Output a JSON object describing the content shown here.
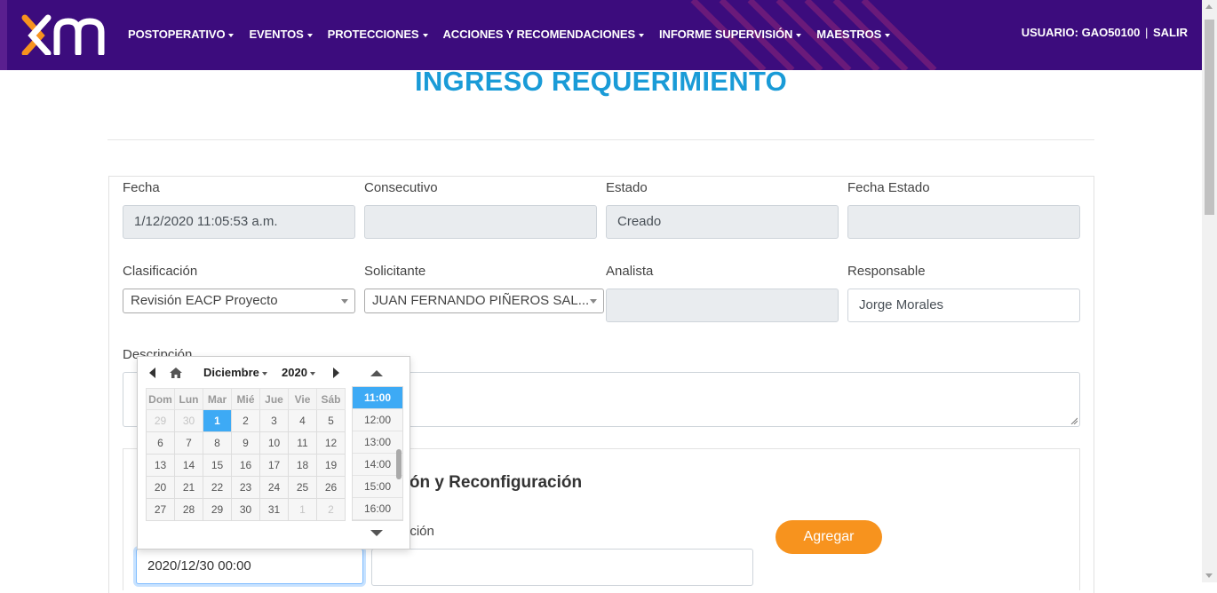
{
  "nav": {
    "menu": [
      {
        "label": "POSTOPERATIVO"
      },
      {
        "label": "EVENTOS"
      },
      {
        "label": "PROTECCIONES"
      },
      {
        "label": "ACCIONES Y RECOMENDACIONES"
      },
      {
        "label": "INFORME SUPERVISIÓN"
      },
      {
        "label": "MAESTROS"
      }
    ],
    "user_label": "USUARIO: GAO50100",
    "separator": "|",
    "logout_label": "SALIR",
    "brand_color": "#3c0c7d",
    "logo_accent": "#f7931e"
  },
  "page_title": "INGRESO REQUERIMIENTO",
  "form": {
    "fecha": {
      "label": "Fecha",
      "value": "1/12/2020 11:05:53 a.m."
    },
    "consecutivo": {
      "label": "Consecutivo",
      "value": ""
    },
    "estado": {
      "label": "Estado",
      "value": "Creado"
    },
    "fecha_estado": {
      "label": "Fecha Estado",
      "value": ""
    },
    "clasificacion": {
      "label": "Clasificación",
      "value": "Revisión EACP Proyecto"
    },
    "solicitante": {
      "label": "Solicitante",
      "value": "JUAN FERNANDO PIÑEROS SAL..."
    },
    "analista": {
      "label": "Analista",
      "value": ""
    },
    "responsable": {
      "label": "Responsable",
      "value": "Jorge Morales"
    },
    "descripcion": {
      "label": "Descripción",
      "value": ""
    }
  },
  "subsection": {
    "title_visible": "ción y Reconfiguración",
    "desc_label_visible": "pción",
    "date_value": "2020/12/30 00:00",
    "add_button": "Agregar"
  },
  "picker": {
    "month": "Diciembre",
    "year": "2020",
    "weekdays": [
      "Dom",
      "Lun",
      "Mar",
      "Mié",
      "Jue",
      "Vie",
      "Sáb"
    ],
    "weeks": [
      [
        "29",
        "30",
        "1",
        "2",
        "3",
        "4",
        "5"
      ],
      [
        "6",
        "7",
        "8",
        "9",
        "10",
        "11",
        "12"
      ],
      [
        "13",
        "14",
        "15",
        "16",
        "17",
        "18",
        "19"
      ],
      [
        "20",
        "21",
        "22",
        "23",
        "24",
        "25",
        "26"
      ],
      [
        "27",
        "28",
        "29",
        "30",
        "31",
        "1",
        "2"
      ]
    ],
    "selected_day": "1",
    "times": [
      "11:00",
      "12:00",
      "13:00",
      "14:00",
      "15:00",
      "16:00"
    ],
    "selected_time": "11:00"
  }
}
